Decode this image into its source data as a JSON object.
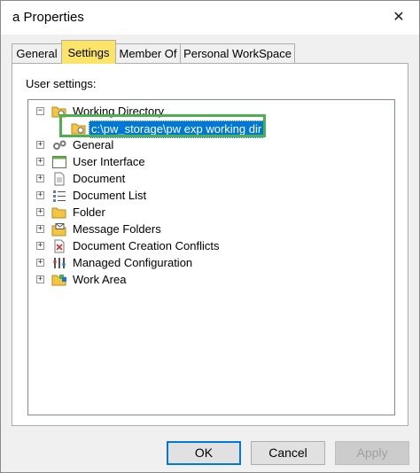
{
  "window": {
    "title": "a Properties",
    "close_glyph": "✕"
  },
  "tabs": [
    {
      "label": "General",
      "active": false
    },
    {
      "label": "Settings",
      "active": true
    },
    {
      "label": "Member Of",
      "active": false
    },
    {
      "label": "Personal WorkSpace",
      "active": false
    }
  ],
  "panel": {
    "label": "User settings:"
  },
  "tree": {
    "items": [
      {
        "label": "Working Directory",
        "expander": "−",
        "icon": "folder-gear-icon"
      },
      {
        "label": "c:\\pw_storage\\pw exp working dir",
        "icon": "folder-gear-icon",
        "selected": true
      },
      {
        "label": "General",
        "expander": "+",
        "icon": "gears-icon"
      },
      {
        "label": "User Interface",
        "expander": "+",
        "icon": "window-icon"
      },
      {
        "label": "Document",
        "expander": "+",
        "icon": "document-icon"
      },
      {
        "label": "Document List",
        "expander": "+",
        "icon": "list-icon"
      },
      {
        "label": "Folder",
        "expander": "+",
        "icon": "folder-icon"
      },
      {
        "label": "Message Folders",
        "expander": "+",
        "icon": "message-folder-icon"
      },
      {
        "label": "Document Creation Conflicts",
        "expander": "+",
        "icon": "document-conflict-icon"
      },
      {
        "label": "Managed Configuration",
        "expander": "+",
        "icon": "tools-icon"
      },
      {
        "label": "Work Area",
        "expander": "+",
        "icon": "work-area-icon"
      }
    ]
  },
  "buttons": {
    "ok": "OK",
    "cancel": "Cancel",
    "apply": "Apply"
  },
  "colors": {
    "active_tab": "#fbe467",
    "selection": "#0078d7",
    "highlight_box": "#4caf50"
  }
}
